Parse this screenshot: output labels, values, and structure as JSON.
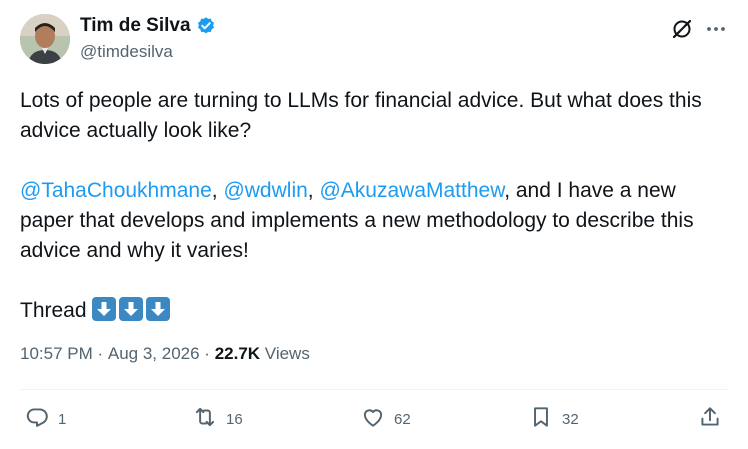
{
  "author": {
    "display_name": "Tim de Silva",
    "handle": "@timdesilva",
    "verified": true
  },
  "tweet": {
    "line1": "Lots of people are turning to LLMs for financial advice. But what does this advice actually look like?",
    "para2": {
      "mention1": "@TahaChoukhmane",
      "sep1": ", ",
      "mention2": "@wdwlin",
      "sep2": ", ",
      "mention3": "@AkuzawaMatthew",
      "rest": ", and I have a new paper that develops and implements a new methodology to describe this advice and why it varies!"
    },
    "thread_label": "Thread",
    "emoji": [
      "down-arrow-emoji",
      "down-arrow-emoji",
      "down-arrow-emoji"
    ]
  },
  "meta": {
    "time": "10:57 PM",
    "dot1": " · ",
    "date": "Aug 3, 2026",
    "dot2": " · ",
    "views_count": "22.7K",
    "views_label": " Views"
  },
  "actions": {
    "reply_count": "1",
    "retweet_count": "16",
    "like_count": "62",
    "bookmark_count": "32"
  },
  "colors": {
    "link": "#1d9bf0",
    "text": "#0f1419",
    "secondary": "#536471",
    "emoji_bg": "#3b88c3"
  }
}
